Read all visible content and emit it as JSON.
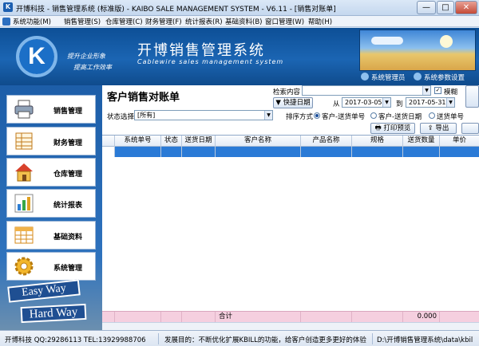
{
  "window": {
    "title": "开博科技 - 销售管理系统 (标准版) - KAIBO SALE MANAGEMENT SYSTEM - V6.11 - [销售对账单]",
    "min": "—",
    "max": "□",
    "close": "✕"
  },
  "menu": [
    "系统功能(M)",
    "销售管理(S)",
    "仓库管理(C)",
    "财务管理(F)",
    "统计报表(R)",
    "基础资料(B)",
    "窗口管理(W)",
    "帮助(H)"
  ],
  "banner": {
    "logo_letter": "K",
    "slogan1": "提升企业形象",
    "slogan2": "提高工作效率",
    "title": "开博销售管理系统",
    "subtitle": "Cablewire sales management system",
    "link1": "系统管理员",
    "link2": "系统参数设置"
  },
  "sidebar": {
    "items": [
      {
        "label": "销售管理",
        "icon": "printer-icon"
      },
      {
        "label": "财务管理",
        "icon": "ledger-icon"
      },
      {
        "label": "仓库管理",
        "icon": "house-icon"
      },
      {
        "label": "统计报表",
        "icon": "bar-chart-icon"
      },
      {
        "label": "基础资料",
        "icon": "table-icon"
      },
      {
        "label": "系统管理",
        "icon": "gear-icon"
      }
    ],
    "sign1": "Easy Way",
    "sign2": "Hard Way"
  },
  "page": {
    "title": "客户销售对账单",
    "search_label": "检索内容",
    "search_value": "",
    "fuzzy_label": "模糊",
    "fuzzy_checked": "✓",
    "quick_date": "快捷日期",
    "from_label": "从",
    "date_from": "2017-03-05",
    "to_label": "到",
    "date_to": "2017-05-31",
    "status_label": "状态选择",
    "status_value": "[所有]",
    "sort_label": "排序方式",
    "sort_options": [
      "客户-送货单号",
      "客户-送货日期",
      "送货单号"
    ],
    "print_btn": "打印预览",
    "export_btn": "导出"
  },
  "table": {
    "columns": [
      "系统单号",
      "状态",
      "送货日期",
      "客户名称",
      "产品名称",
      "规格",
      "送货数量",
      "单价"
    ],
    "total_label": "合计",
    "total_qty": "0.000"
  },
  "status": {
    "company": "开博科技 QQ:29286113 TEL:13929988706",
    "message": "发展目的：不断优化扩展KBILL的功能，给客户创造更多更好的体验",
    "path": "D:\\开博销售管理系统\\data\\kbil"
  },
  "colors": {
    "accent": "#1b65b3",
    "selected_row": "#2a7ad6",
    "total_row": "#f5cfdf"
  }
}
